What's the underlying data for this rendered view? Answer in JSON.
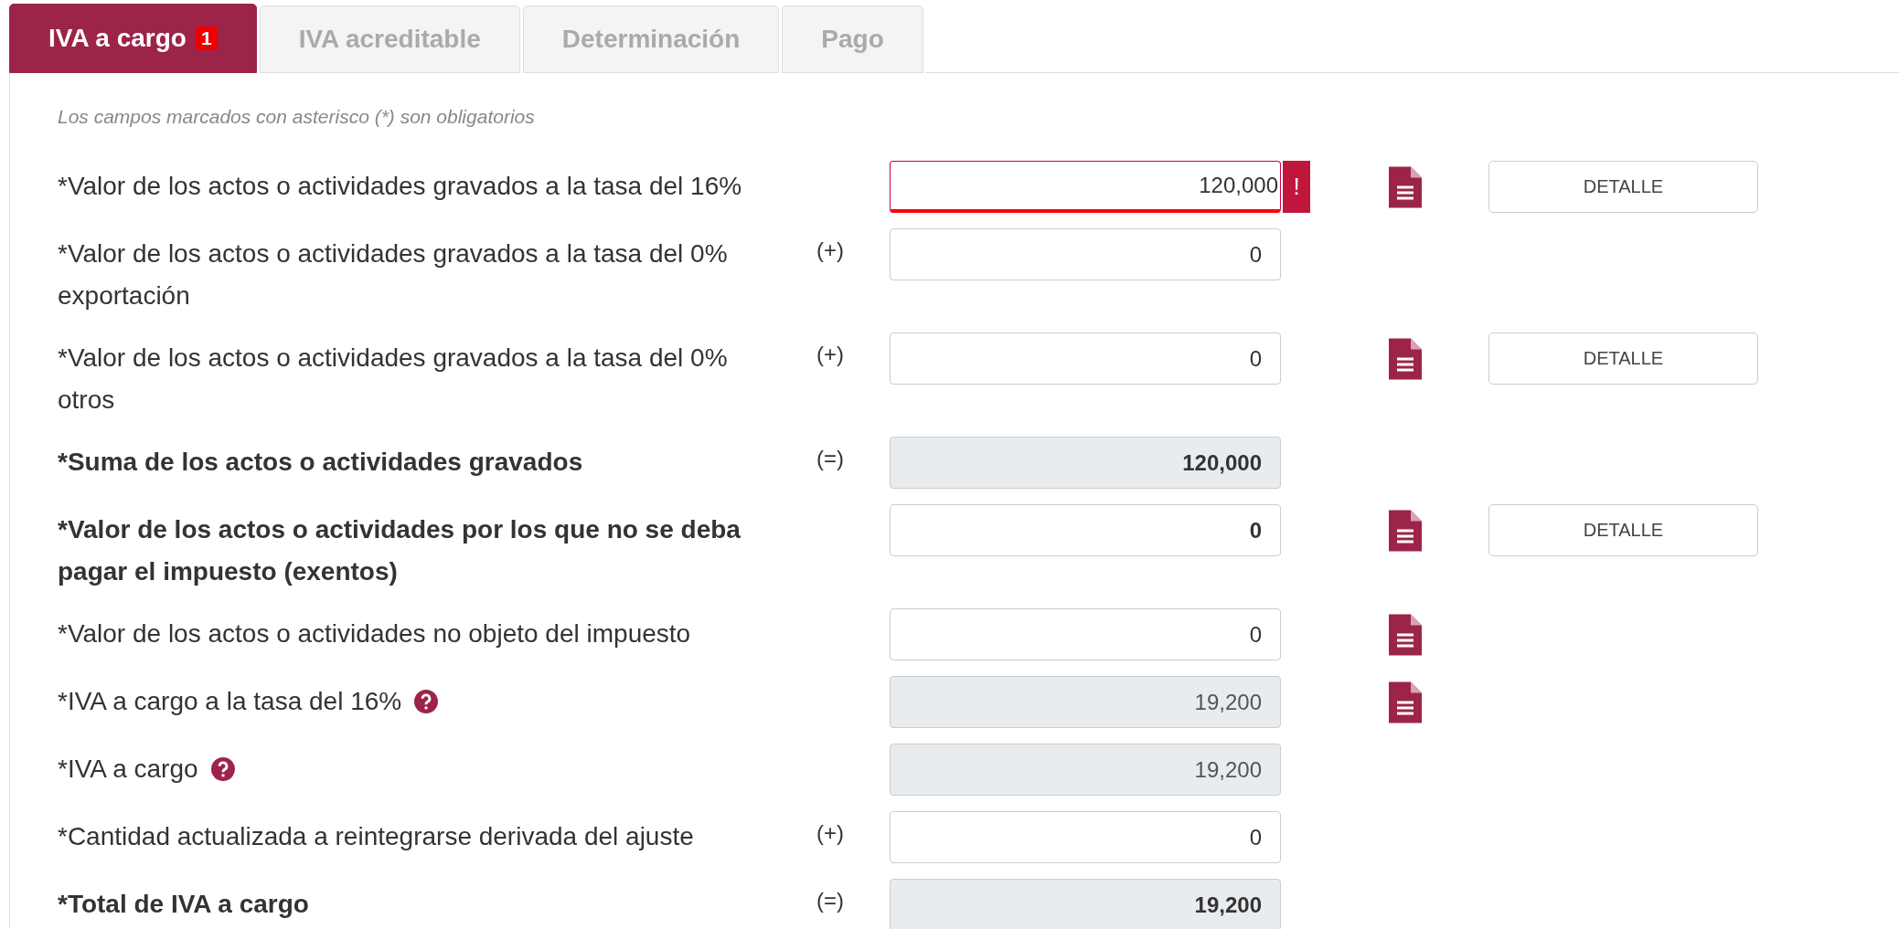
{
  "tabs": [
    {
      "label": "IVA a cargo",
      "badge": "1",
      "selected": true
    },
    {
      "label": "IVA acreditable",
      "selected": false
    },
    {
      "label": "Determinación",
      "selected": false
    },
    {
      "label": "Pago",
      "selected": false
    }
  ],
  "note": "Los campos marcados con asterisco (*) son obligatorios",
  "rows": [
    {
      "label": "*Valor de los actos o actividades gravados a la tasa del 16%",
      "strong": false,
      "help": false,
      "value": "120,000",
      "readonly": false,
      "error": true,
      "error_mark": "!",
      "document": true,
      "button": "DETALLE"
    },
    {
      "label": "*Valor de los actos o actividades gravados a la tasa del 0% exportación",
      "strong": false,
      "help": false,
      "operator": "(+)",
      "value": "0",
      "readonly": false,
      "error": false,
      "document": false
    },
    {
      "label": "*Valor de los actos o actividades gravados a la tasa del 0% otros",
      "strong": false,
      "help": false,
      "operator": "(+)",
      "value": "0",
      "readonly": false,
      "error": false,
      "document": true,
      "button": "DETALLE"
    },
    {
      "label": "*Suma de los actos o actividades gravados",
      "strong": true,
      "help": false,
      "operator": "(=)",
      "value": "120,000",
      "readonly": true,
      "error": false,
      "document": false
    },
    {
      "label": "*Valor de los actos o actividades por los que no se deba pagar el impuesto (exentos)",
      "strong": true,
      "help": false,
      "value": "0",
      "readonly": false,
      "error": false,
      "document": true,
      "button": "DETALLE"
    },
    {
      "label": "*Valor de los actos o actividades no objeto del impuesto",
      "strong": false,
      "help": false,
      "value": "0",
      "readonly": false,
      "error": false,
      "document": true
    },
    {
      "label": "*IVA a cargo a la tasa del 16%",
      "strong": false,
      "help": true,
      "value": "19,200",
      "readonly": true,
      "error": false,
      "document": true
    },
    {
      "label": "*IVA a cargo",
      "strong": false,
      "help": true,
      "value": "19,200",
      "readonly": true,
      "error": false,
      "document": false
    },
    {
      "label": "*Cantidad actualizada a reintegrarse derivada del ajuste",
      "strong": false,
      "help": false,
      "operator": "(+)",
      "value": "0",
      "readonly": false,
      "error": false,
      "document": false
    },
    {
      "label": "*Total de IVA a cargo",
      "strong": true,
      "help": false,
      "operator": "(=)",
      "value": "19,200",
      "readonly": true,
      "error": false,
      "document": false
    }
  ]
}
